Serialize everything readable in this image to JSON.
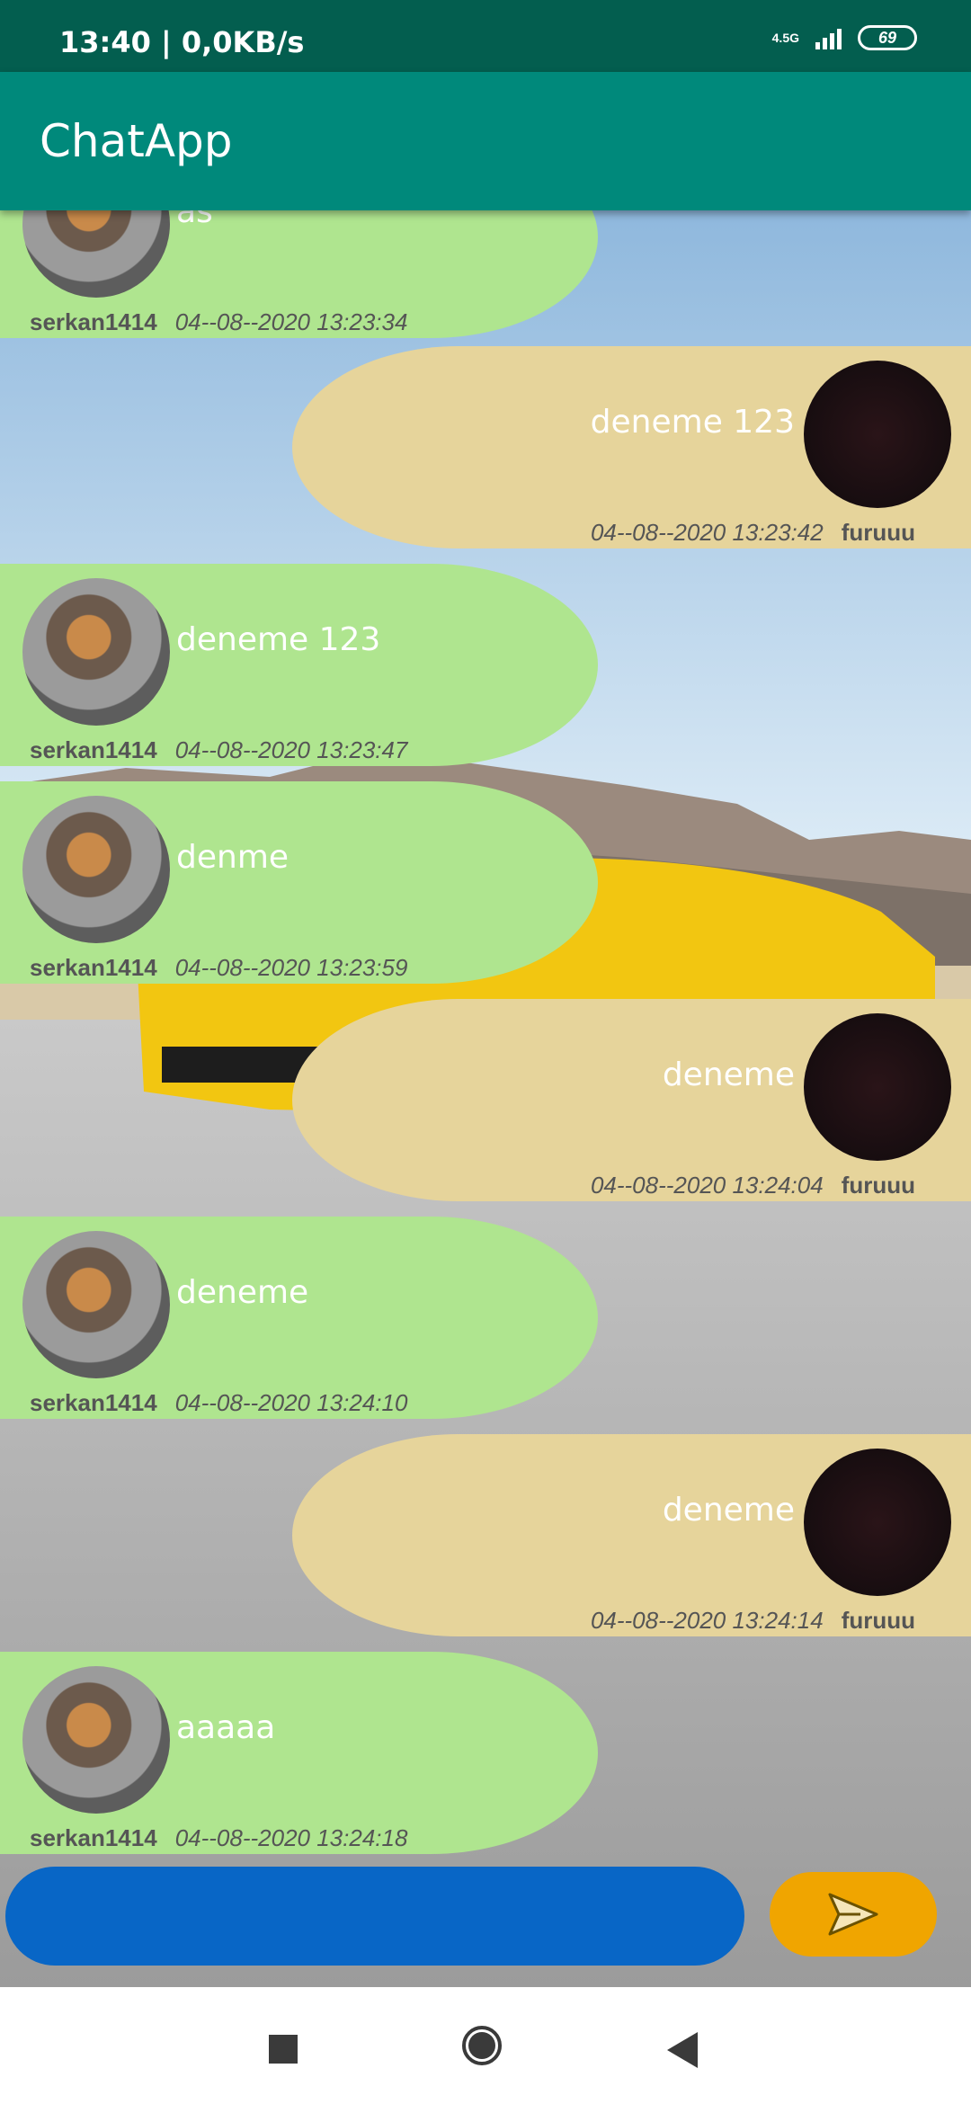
{
  "status_bar": {
    "time": "13:40 | 0,0KB/s",
    "network": "4.5G",
    "battery": "69"
  },
  "app_bar": {
    "title": "ChatApp"
  },
  "messages": [
    {
      "direction": "incoming",
      "text": "as",
      "user": "serkan1414",
      "time": "04--08--2020 13:23:34"
    },
    {
      "direction": "outgoing",
      "text": "deneme 123",
      "user": "furuuu",
      "time": "04--08--2020 13:23:42"
    },
    {
      "direction": "incoming",
      "text": "deneme 123",
      "user": "serkan1414",
      "time": "04--08--2020 13:23:47"
    },
    {
      "direction": "incoming",
      "text": "denme",
      "user": "serkan1414",
      "time": "04--08--2020 13:23:59"
    },
    {
      "direction": "outgoing",
      "text": "deneme",
      "user": "furuuu",
      "time": "04--08--2020 13:24:04"
    },
    {
      "direction": "incoming",
      "text": "deneme",
      "user": "serkan1414",
      "time": "04--08--2020 13:24:10"
    },
    {
      "direction": "outgoing",
      "text": "deneme",
      "user": "furuuu",
      "time": "04--08--2020 13:24:14"
    },
    {
      "direction": "incoming",
      "text": "aaaaa",
      "user": "serkan1414",
      "time": "04--08--2020 13:24:18"
    }
  ],
  "composer": {
    "input_value": "",
    "send_icon": "send-icon"
  },
  "colors": {
    "app_bar": "#00897b",
    "status_bar": "#035e4f",
    "incoming_bubble": "#afe58f",
    "outgoing_bubble": "#e6d49b",
    "input": "#0866c6",
    "send_button": "#f0a500"
  }
}
